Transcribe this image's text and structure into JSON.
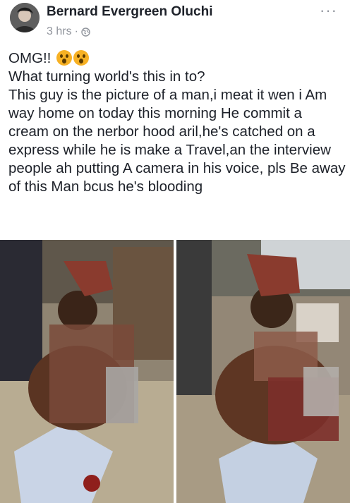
{
  "post": {
    "author": "Bernard Evergreen Oluchi",
    "time": "3 hrs",
    "separator": "·",
    "privacy_icon": "globe-icon",
    "more_icon": "ellipsis-icon",
    "lines": [
      "OMG!!",
      "What turning world's this in to?",
      "This guy is the picture of a man,i meat it wen i Am way home on today this morning He commit a cream on the nerbor hood aril,he's catched on a express while he is make a Travel,an the interview people ah putting A camera in his voice, pls Be away of this Man bcus he's blooding"
    ],
    "emojis": [
      "astonished-face-icon",
      "astonished-face-icon"
    ]
  },
  "colors": {
    "text": "#1d2129",
    "meta": "#90949c",
    "emoji": "#f7b124"
  }
}
